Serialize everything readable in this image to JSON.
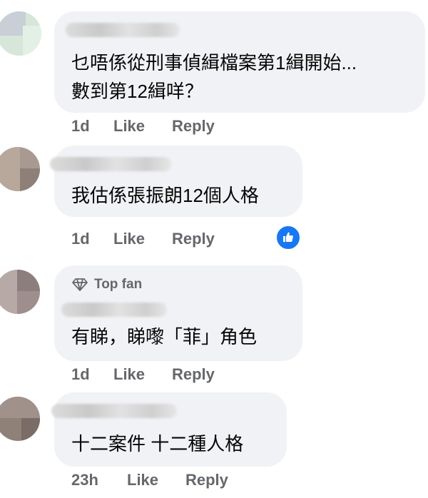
{
  "comments": [
    {
      "text": "乜唔係從刑事偵緝檔案第1緝開始...\n數到第12緝咩？",
      "time": "1d",
      "like_label": "Like",
      "reply_label": "Reply"
    },
    {
      "text": "我估係張振朗12個人格",
      "time": "1d",
      "like_label": "Like",
      "reply_label": "Reply",
      "reaction": "like-icon"
    },
    {
      "badge": "Top fan",
      "text": "有睇，睇嚟「菲」角色",
      "time": "1d",
      "like_label": "Like",
      "reply_label": "Reply"
    },
    {
      "text": "十二案件 十二種人格",
      "time": "23h",
      "like_label": "Like",
      "reply_label": "Reply"
    }
  ],
  "colors": {
    "bubble": "#f0f2f5",
    "secondary_text": "#65676b",
    "like_blue": "#1877f2"
  }
}
